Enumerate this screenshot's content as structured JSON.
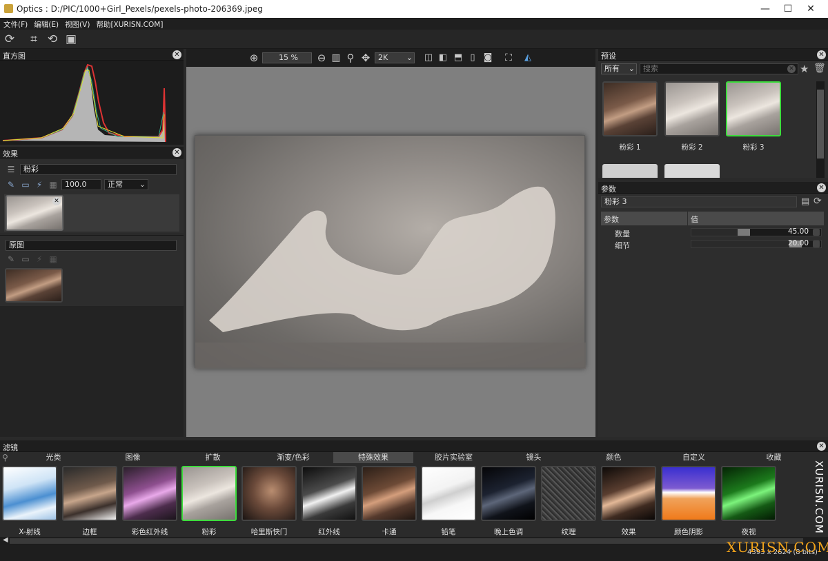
{
  "window": {
    "title": "Optics : D:/PIC/1000+Girl_Pexels/pexels-photo-206369.jpeg",
    "minimize": "—",
    "maximize": "☐",
    "close": "✕"
  },
  "menu": [
    "文件(F)",
    "编辑(E)",
    "视图(V)",
    "帮助[XURISN.COM]"
  ],
  "histogram": {
    "title": "直方图"
  },
  "effects": {
    "title": "效果",
    "layer_name": "粉彩",
    "opacity": "100.0",
    "blend_mode": "正常",
    "original_label": "原图"
  },
  "viewer": {
    "zoom": "15 %",
    "resolution": "2K"
  },
  "presets": {
    "title": "预设",
    "category": "所有",
    "search_placeholder": "搜索",
    "items": [
      {
        "label": "粉彩 1"
      },
      {
        "label": "粉彩 2"
      },
      {
        "label": "粉彩 3"
      }
    ]
  },
  "params": {
    "title": "参数",
    "preset_name": "粉彩 3",
    "col_param": "参数",
    "col_value": "值",
    "rows": [
      {
        "name": "数量",
        "value": "45.00",
        "level": 0.45
      },
      {
        "name": "细节",
        "value": "20.00",
        "level": 0.85
      }
    ]
  },
  "filters": {
    "title": "滤镜",
    "tabs": [
      "光类",
      "图像",
      "扩散",
      "渐变/色彩",
      "特殊效果",
      "胶片实验室",
      "镜头",
      "颜色",
      "自定义",
      "收藏"
    ],
    "active_tab": "特殊效果",
    "items": [
      "X-射线",
      "边框",
      "彩色红外线",
      "粉彩",
      "哈里斯快门",
      "红外线",
      "卡通",
      "铅笔",
      "晚上色调",
      "纹理",
      "效果",
      "颜色阴影",
      "夜视"
    ],
    "selected_item": "粉彩"
  },
  "status": {
    "image_info": "4393 x 2624 (8 bits)"
  },
  "watermark": {
    "side": "XURISN.COM",
    "bottom": "XURISN.COM"
  }
}
